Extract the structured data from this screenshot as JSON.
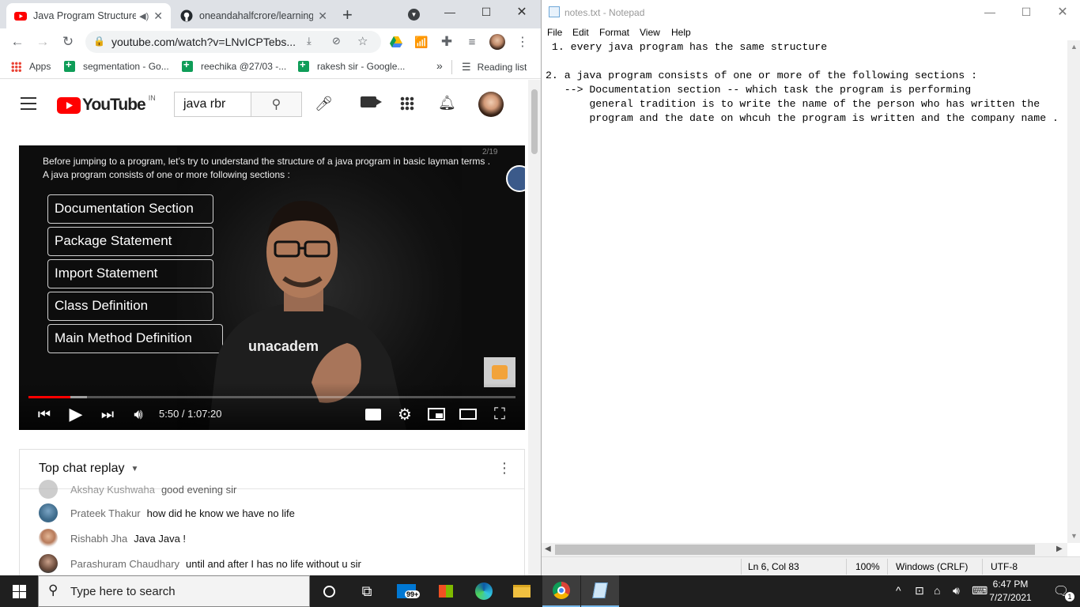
{
  "browser": {
    "tabs": [
      {
        "title": "Java Program Structure",
        "active": true
      },
      {
        "title": "oneandahalfcrore/learning",
        "active": false
      }
    ],
    "new_tab": "+",
    "url": "youtube.com/watch?v=LNvICPTebs...",
    "bookmarks": {
      "apps": "Apps",
      "items": [
        "segmentation - Go...",
        "reechika @27/03 -...",
        "rakesh sir - Google..."
      ],
      "more": "»",
      "reading_list": "Reading list"
    }
  },
  "youtube": {
    "logo": "YouTube",
    "country": "IN",
    "search_value": "java rbr",
    "video": {
      "slide_counter": "2/19",
      "slide_line1": "Before jumping to a program, let’s try to understand the structure of a java program in basic layman terms .",
      "slide_line2": "A java program consists of one or more following sections :",
      "sections": [
        "Documentation Section",
        "Package Statement",
        "Import Statement",
        "Class Definition",
        "Main Method Definition"
      ],
      "shirt_text": "unacadem",
      "time": "5:50 / 1:07:20",
      "progress_played": 0.086,
      "progress_buffered": 0.12
    },
    "chat": {
      "header": "Top chat replay",
      "rows": [
        {
          "author": "Akshay Kushwaha",
          "message": "good evening sir"
        },
        {
          "author": "Prateek Thakur",
          "message": "how did he know we have no life"
        },
        {
          "author": "Rishabh Jha",
          "message": "Java Java !"
        },
        {
          "author": "Parashuram Chaudhary",
          "message": "until and after I has no life without u sir"
        }
      ]
    }
  },
  "notepad": {
    "title": "notes.txt - Notepad",
    "menu": [
      "File",
      "Edit",
      "Format",
      "View",
      "Help"
    ],
    "lines": [
      " 1. every java program has the same structure",
      "",
      "2. a java program consists of one or more of the following sections :",
      "   --> Documentation section -- which task the program is performing",
      "       general tradition is to write the name of the person who has written the",
      "       program and the date on whcuh the program is written and the company name ."
    ],
    "status": {
      "position": "Ln 6, Col 83",
      "zoom": "100%",
      "line_ending": "Windows (CRLF)",
      "encoding": "UTF-8"
    }
  },
  "taskbar": {
    "search_placeholder": "Type here to search",
    "mail_badge": "99+",
    "time": "6:47 PM",
    "date": "7/27/2021",
    "notification_count": "1"
  }
}
